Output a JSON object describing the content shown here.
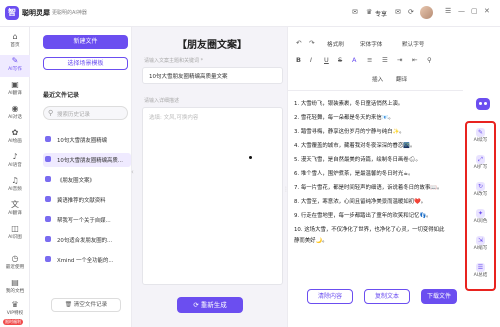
{
  "app": {
    "logo_glyph": "智",
    "name": "聪明灵犀",
    "slogan": "更聪明的AI神器"
  },
  "topbar": {
    "icons": [
      "message-icon",
      "refresh-icon",
      "mail-icon",
      "crown-icon",
      "gift-icon",
      "user-avatar",
      "minimize-icon",
      "maximize-icon",
      "close-icon"
    ],
    "benefit_label": "专享"
  },
  "sidebar": {
    "items": [
      {
        "label": "首页",
        "icon": "⌂"
      },
      {
        "label": "AI写作",
        "icon": "✎"
      },
      {
        "label": "AI翻译",
        "icon": "▣"
      },
      {
        "label": "AI对话",
        "icon": "◉"
      },
      {
        "label": "AI绘画",
        "icon": "✿"
      },
      {
        "label": "AI语音",
        "icon": "♪"
      },
      {
        "label": "AI音频",
        "icon": "♫"
      },
      {
        "label": "AI翻译",
        "icon": "文"
      },
      {
        "label": "AI识图",
        "icon": "◫"
      },
      {
        "label": "最近使用",
        "icon": "◷"
      },
      {
        "label": "我的文档",
        "icon": "▤"
      },
      {
        "label": "VIP特权",
        "icon": "♛"
      }
    ],
    "vip_badge": "限时福利"
  },
  "files": {
    "new_file": "新建文件",
    "choose_template": "选择场景模板",
    "records_title": "最近文件记录",
    "search_placeholder": "搜索历史记录",
    "records": [
      "10句大雪朋友圈精编",
      "10句大雪朋友圈精编高质...",
      "《朋友圈文案》",
      "冀语推荐的文献资料",
      "帮我写一个关于自媒...",
      "20句适合发朋友圈的...",
      "Xmind 一个全功能的..."
    ],
    "clear": "清空文件记录"
  },
  "editor": {
    "title": "【朋友圈文案】",
    "topic_label": "请输入文案主题和关键词 *",
    "topic_value": "10句大雪朋友圈精编高质量文案",
    "desc_label": "请输入详细描述",
    "desc_placeholder": "选填: 文风,可换内容",
    "regenerate": "重新生成"
  },
  "result": {
    "toolbar_row1": [
      "↶",
      "↷",
      "格式刷",
      "宋体字体",
      "默认字号"
    ],
    "toolbar_row2": [
      "B",
      "I",
      "U",
      "S",
      "A",
      "≡",
      "☰",
      "⇥",
      "⇤",
      "⚲"
    ],
    "toolbar_row3": [
      "插入",
      "翻译"
    ],
    "lines": [
      "1. 大雪纷飞，银装素裹，冬日童话悄然上演。",
      "2. 雪花轻舞，每一朵都是冬天的来信📧。",
      "3. 踏雪寻梅，静享这份岁月的宁静与纯白✨。",
      "4. 大雪覆盖的城市，藏着我对冬夜深深的眷恋🌃。",
      "5. 漫天飞雪，是自然最美的诗篇，绘制冬日画卷🌨。",
      "6. 堆个雪人，围炉煮茶，是最温馨的冬日时光☕。",
      "7. 每一片雪花，都是时间轻声的细语，诉说着冬日的故事📖。",
      "8. 大雪至，寒意浓，心间且留纯净美景而温暖如初❤️。",
      "9. 行走在雪地里，每一步都踏出了童年的欢笑和记忆👣。",
      "10. 这场大雪，不仅净化了世界，也净化了心灵，一切变得如此",
      "静而美好🌙。"
    ],
    "buttons": {
      "clear": "清除内容",
      "copy": "复制文本",
      "download": "下载文件"
    }
  },
  "ai_tools": [
    {
      "label": "AI续写",
      "icon": "✎"
    },
    {
      "label": "AI扩写",
      "icon": "⤢"
    },
    {
      "label": "AI改写",
      "icon": "↻"
    },
    {
      "label": "AI润色",
      "icon": "✦"
    },
    {
      "label": "AI缩写",
      "icon": "⇲"
    },
    {
      "label": "AI总结",
      "icon": "☰"
    }
  ],
  "colors": {
    "accent": "#6b4ef0",
    "highlight_border": "#e8231f"
  }
}
